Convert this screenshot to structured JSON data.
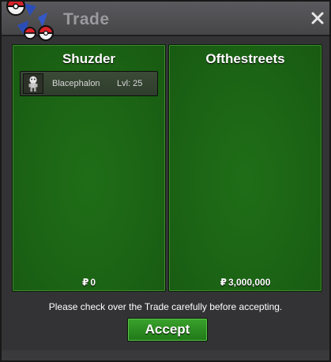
{
  "window": {
    "title": "Trade",
    "close_icon": "close-icon",
    "logo_icon": "pokeball-logo-icon"
  },
  "trade": {
    "left": {
      "player_name": "Shuzder",
      "items": [
        {
          "sprite_icon": "blacephalon-sprite-icon",
          "name": "Blacephalon",
          "level": "Lvl: 25"
        }
      ],
      "currency_symbol": "₽",
      "money": "0"
    },
    "right": {
      "player_name": "Ofthestreets",
      "items": [],
      "currency_symbol": "₽",
      "money": "3,000,000"
    }
  },
  "footer": {
    "notice": "Please check over the Trade carefully before accepting.",
    "accept_label": "Accept"
  },
  "colors": {
    "panel_green": "#1c6415",
    "accept_green": "#2d8f22",
    "titlebar": "#505054"
  }
}
